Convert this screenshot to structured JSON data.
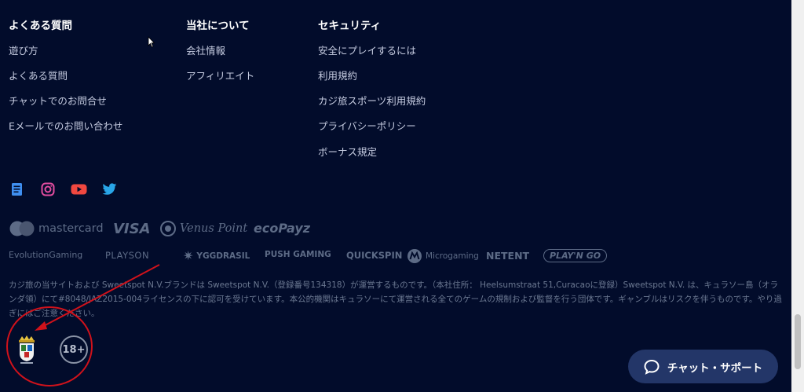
{
  "footer": {
    "columns": [
      {
        "title": "よくある質問",
        "links": [
          "遊び方",
          "よくある質問",
          "チャットでのお問合せ",
          "Eメールでのお問い合わせ"
        ]
      },
      {
        "title": "当社について",
        "links": [
          "会社情報",
          "アフィリエイト"
        ]
      },
      {
        "title": "セキュリティ",
        "links": [
          "安全にプレイするには",
          "利用規約",
          "カジ旅スポーツ利用規約",
          "プライバシーポリシー",
          "ボーナス規定"
        ]
      }
    ],
    "social_icons": [
      "blog-icon",
      "instagram-icon",
      "youtube-icon",
      "twitter-icon"
    ],
    "payment_logos": [
      "mastercard",
      "VISA",
      "Venus Point",
      "ecoPayz"
    ],
    "provider_logos": [
      "EvolutionGaming",
      "PLAYSON",
      "YGGDRASIL",
      "PUSH GAMING",
      "QUICKSPIN",
      "Microgaming",
      "NETENT",
      "PLAY'N GO"
    ],
    "disclaimer": "カジ旅の当サイトおよび Sweetspot N.V.ブランドは Sweetspot N.V.（登録番号134318）が運営するものです。（本社住所： Heelsumstraat 51,Curacaoに登録）Sweetspot N.V. は、キュラソー島（オランダ領）にて#8048/JAZ2015-004ライセンスの下に認可を受けています。本公的機関はキュラソーにて運営される全てのゲームの規制および監督を行う団体です。ギャンブルはリスクを伴うものです。やり過ぎにはご注意ください。",
    "age_badge": "18+"
  },
  "chat_button": {
    "label": "チャット・サポート"
  },
  "colors": {
    "background": "#020c2b",
    "chat_button": "#233668",
    "annotation": "#d0121b"
  }
}
